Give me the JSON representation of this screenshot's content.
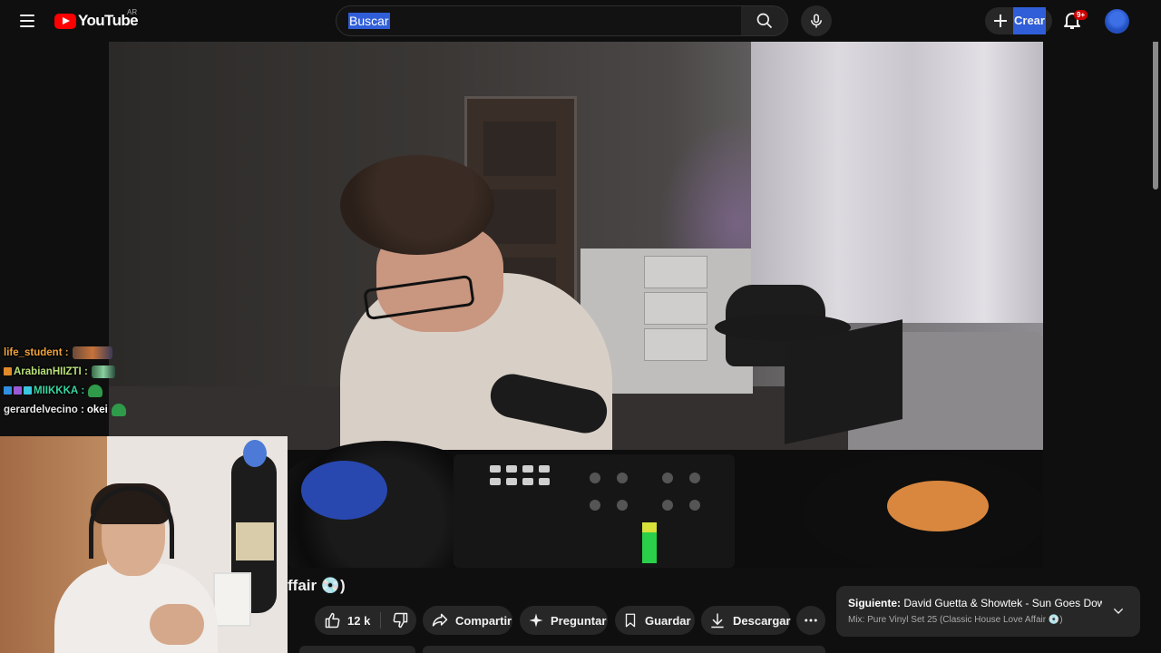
{
  "header": {
    "logo_text": "YouTube",
    "country_code": "AR",
    "search_placeholder": "Buscar",
    "search_text": "Buscar",
    "create_label": "Crear",
    "notifications_badge": "9+"
  },
  "chat": [
    {
      "user": "life_student",
      "message": "",
      "color": "#f0a23a"
    },
    {
      "user": "ArabianHIIZTI",
      "message": "",
      "color": "#b8e07a"
    },
    {
      "user": "MIIKKKA",
      "message": "",
      "color": "#38d6a0"
    },
    {
      "user": "gerardelvecino",
      "message": "okei",
      "color": "#e6e6e6"
    }
  ],
  "video": {
    "title_fragment": "ffair 💿)"
  },
  "actions": {
    "like_count": "12 k",
    "share_label": "Compartir",
    "ask_label": "Preguntar",
    "save_label": "Guardar",
    "download_label": "Descargar"
  },
  "up_next": {
    "prefix": "Siguiente:",
    "title": "David Guetta & Showtek - Sun Goes Dow...",
    "playlist": "Mix: Pure Vinyl Set 25 (Classic House Love Affair 💿)"
  },
  "colors": {
    "background": "#0f0f0f",
    "pill": "#272727",
    "brand_red": "#ff0000",
    "selection_blue": "#2f5ed8"
  }
}
